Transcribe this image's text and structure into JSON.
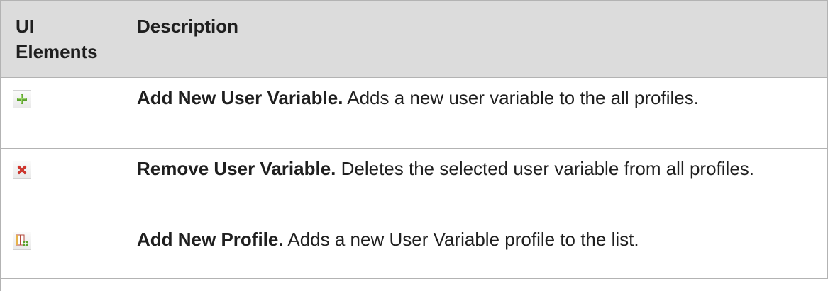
{
  "table": {
    "headers": {
      "ui_elements": "UI Elements",
      "description": "Description"
    },
    "rows": [
      {
        "icon": "add-plus-icon",
        "term": "Add New User Variable.",
        "text": " Adds a new user variable to the all profiles."
      },
      {
        "icon": "remove-x-icon",
        "term": "Remove User Variable.",
        "text": " Deletes the selected user variable from all profiles."
      },
      {
        "icon": "add-profile-icon",
        "term": "Add New Profile.",
        "text": " Adds a new User Variable profile to the list."
      }
    ]
  },
  "colors": {
    "header_bg": "#dcdcdc",
    "border": "#b3b3b3",
    "add_icon_green": "#5aa02c",
    "remove_icon_red": "#d9342b"
  }
}
